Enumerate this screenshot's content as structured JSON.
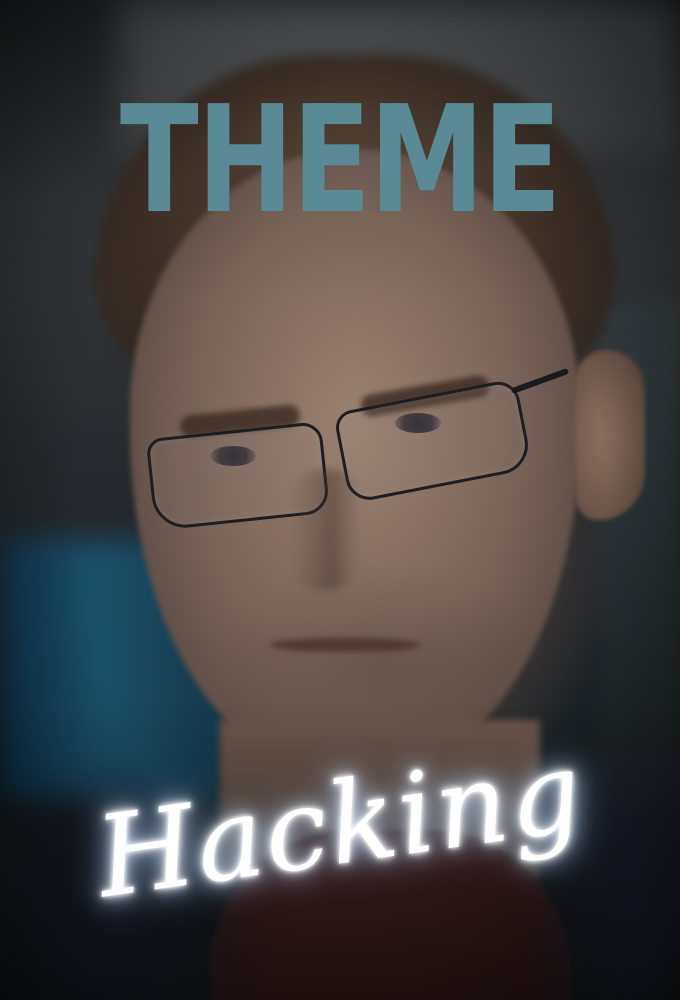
{
  "poster": {
    "title": "THEME",
    "subtitle": "Hacking"
  },
  "colors": {
    "title": "#5a8a96",
    "neon": "#ffffff",
    "neon_glow": "#9cc8ff"
  }
}
